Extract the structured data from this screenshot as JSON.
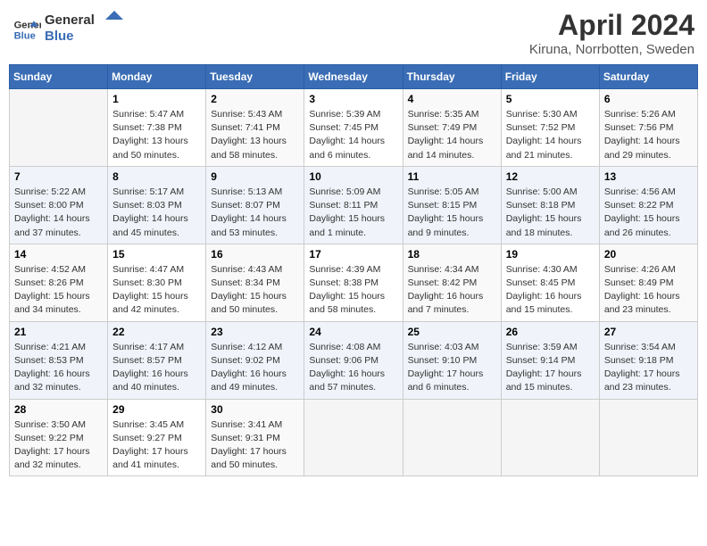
{
  "header": {
    "logo_line1": "General",
    "logo_line2": "Blue",
    "month": "April 2024",
    "location": "Kiruna, Norrbotten, Sweden"
  },
  "weekdays": [
    "Sunday",
    "Monday",
    "Tuesday",
    "Wednesday",
    "Thursday",
    "Friday",
    "Saturday"
  ],
  "weeks": [
    [
      {
        "day": "",
        "sunrise": "",
        "sunset": "",
        "daylight": ""
      },
      {
        "day": "1",
        "sunrise": "5:47 AM",
        "sunset": "7:38 PM",
        "daylight": "13 hours and 50 minutes."
      },
      {
        "day": "2",
        "sunrise": "5:43 AM",
        "sunset": "7:41 PM",
        "daylight": "13 hours and 58 minutes."
      },
      {
        "day": "3",
        "sunrise": "5:39 AM",
        "sunset": "7:45 PM",
        "daylight": "14 hours and 6 minutes."
      },
      {
        "day": "4",
        "sunrise": "5:35 AM",
        "sunset": "7:49 PM",
        "daylight": "14 hours and 14 minutes."
      },
      {
        "day": "5",
        "sunrise": "5:30 AM",
        "sunset": "7:52 PM",
        "daylight": "14 hours and 21 minutes."
      },
      {
        "day": "6",
        "sunrise": "5:26 AM",
        "sunset": "7:56 PM",
        "daylight": "14 hours and 29 minutes."
      }
    ],
    [
      {
        "day": "7",
        "sunrise": "5:22 AM",
        "sunset": "8:00 PM",
        "daylight": "14 hours and 37 minutes."
      },
      {
        "day": "8",
        "sunrise": "5:17 AM",
        "sunset": "8:03 PM",
        "daylight": "14 hours and 45 minutes."
      },
      {
        "day": "9",
        "sunrise": "5:13 AM",
        "sunset": "8:07 PM",
        "daylight": "14 hours and 53 minutes."
      },
      {
        "day": "10",
        "sunrise": "5:09 AM",
        "sunset": "8:11 PM",
        "daylight": "15 hours and 1 minute."
      },
      {
        "day": "11",
        "sunrise": "5:05 AM",
        "sunset": "8:15 PM",
        "daylight": "15 hours and 9 minutes."
      },
      {
        "day": "12",
        "sunrise": "5:00 AM",
        "sunset": "8:18 PM",
        "daylight": "15 hours and 18 minutes."
      },
      {
        "day": "13",
        "sunrise": "4:56 AM",
        "sunset": "8:22 PM",
        "daylight": "15 hours and 26 minutes."
      }
    ],
    [
      {
        "day": "14",
        "sunrise": "4:52 AM",
        "sunset": "8:26 PM",
        "daylight": "15 hours and 34 minutes."
      },
      {
        "day": "15",
        "sunrise": "4:47 AM",
        "sunset": "8:30 PM",
        "daylight": "15 hours and 42 minutes."
      },
      {
        "day": "16",
        "sunrise": "4:43 AM",
        "sunset": "8:34 PM",
        "daylight": "15 hours and 50 minutes."
      },
      {
        "day": "17",
        "sunrise": "4:39 AM",
        "sunset": "8:38 PM",
        "daylight": "15 hours and 58 minutes."
      },
      {
        "day": "18",
        "sunrise": "4:34 AM",
        "sunset": "8:42 PM",
        "daylight": "16 hours and 7 minutes."
      },
      {
        "day": "19",
        "sunrise": "4:30 AM",
        "sunset": "8:45 PM",
        "daylight": "16 hours and 15 minutes."
      },
      {
        "day": "20",
        "sunrise": "4:26 AM",
        "sunset": "8:49 PM",
        "daylight": "16 hours and 23 minutes."
      }
    ],
    [
      {
        "day": "21",
        "sunrise": "4:21 AM",
        "sunset": "8:53 PM",
        "daylight": "16 hours and 32 minutes."
      },
      {
        "day": "22",
        "sunrise": "4:17 AM",
        "sunset": "8:57 PM",
        "daylight": "16 hours and 40 minutes."
      },
      {
        "day": "23",
        "sunrise": "4:12 AM",
        "sunset": "9:02 PM",
        "daylight": "16 hours and 49 minutes."
      },
      {
        "day": "24",
        "sunrise": "4:08 AM",
        "sunset": "9:06 PM",
        "daylight": "16 hours and 57 minutes."
      },
      {
        "day": "25",
        "sunrise": "4:03 AM",
        "sunset": "9:10 PM",
        "daylight": "17 hours and 6 minutes."
      },
      {
        "day": "26",
        "sunrise": "3:59 AM",
        "sunset": "9:14 PM",
        "daylight": "17 hours and 15 minutes."
      },
      {
        "day": "27",
        "sunrise": "3:54 AM",
        "sunset": "9:18 PM",
        "daylight": "17 hours and 23 minutes."
      }
    ],
    [
      {
        "day": "28",
        "sunrise": "3:50 AM",
        "sunset": "9:22 PM",
        "daylight": "17 hours and 32 minutes."
      },
      {
        "day": "29",
        "sunrise": "3:45 AM",
        "sunset": "9:27 PM",
        "daylight": "17 hours and 41 minutes."
      },
      {
        "day": "30",
        "sunrise": "3:41 AM",
        "sunset": "9:31 PM",
        "daylight": "17 hours and 50 minutes."
      },
      {
        "day": "",
        "sunrise": "",
        "sunset": "",
        "daylight": ""
      },
      {
        "day": "",
        "sunrise": "",
        "sunset": "",
        "daylight": ""
      },
      {
        "day": "",
        "sunrise": "",
        "sunset": "",
        "daylight": ""
      },
      {
        "day": "",
        "sunrise": "",
        "sunset": "",
        "daylight": ""
      }
    ]
  ]
}
